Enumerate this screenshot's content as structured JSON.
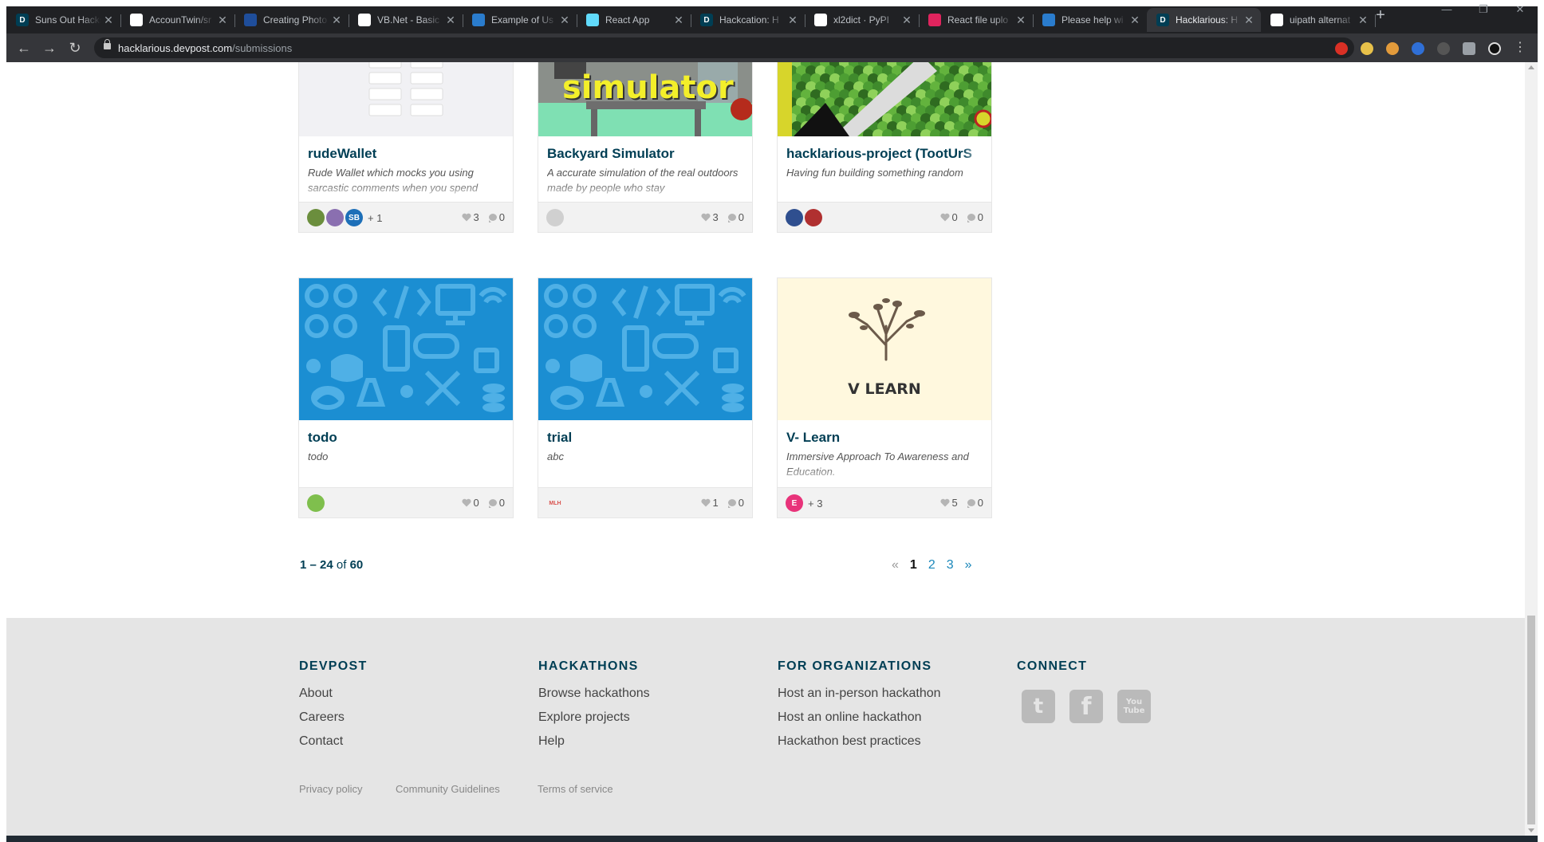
{
  "browser": {
    "tabs": [
      {
        "title": "Suns Out Hacks",
        "icon": "devpost-icon",
        "fav_color": "#003e54",
        "fav_glyph": "D"
      },
      {
        "title": "AccounTwin/sr",
        "icon": "github-icon",
        "fav_color": "#ffffff",
        "fav_glyph": ""
      },
      {
        "title": "Creating Photo",
        "icon": "site-icon",
        "fav_color": "#1f4e9b",
        "fav_glyph": ""
      },
      {
        "title": "VB.Net - Basic",
        "icon": "tutorialspoint-icon",
        "fav_color": "#ffffff",
        "fav_glyph": ""
      },
      {
        "title": "Example of Us",
        "icon": "uipath-icon",
        "fav_color": "#2a7ccd",
        "fav_glyph": ""
      },
      {
        "title": "React App",
        "icon": "react-icon",
        "fav_color": "#61dafb",
        "fav_glyph": ""
      },
      {
        "title": "Hackcation: H",
        "icon": "devpost-icon",
        "fav_color": "#003e54",
        "fav_glyph": "D"
      },
      {
        "title": "xl2dict · PyPI",
        "icon": "pypi-icon",
        "fav_color": "#ffffff",
        "fav_glyph": ""
      },
      {
        "title": "React file uplo",
        "icon": "heart-icon",
        "fav_color": "#e0245e",
        "fav_glyph": ""
      },
      {
        "title": "Please help wi",
        "icon": "uipath-icon",
        "fav_color": "#2a7ccd",
        "fav_glyph": ""
      },
      {
        "title": "Hacklarious: H",
        "icon": "devpost-icon",
        "fav_color": "#003e54",
        "fav_glyph": "D"
      },
      {
        "title": "uipath alternat",
        "icon": "google-icon",
        "fav_color": "#ffffff",
        "fav_glyph": ""
      }
    ],
    "active_tab": 10,
    "url_host": "hacklarious.devpost.com",
    "url_path": "/submissions"
  },
  "cards": [
    {
      "name": "rudeWallet",
      "tagline": "Rude Wallet which mocks you using sarcastic comments when you spend",
      "likes": "3",
      "comments": "0",
      "extra": "+ 1",
      "avatars": [
        "#6b8e3d",
        "#8a6fb0",
        "#1d6fb8"
      ],
      "av_text": [
        "",
        "",
        "SB"
      ],
      "thumb": "wallet"
    },
    {
      "name": "Backyard Simulator",
      "tagline": "A accurate simulation of the real outdoors made by people who stay",
      "likes": "3",
      "comments": "0",
      "extra": "",
      "avatars": [
        "#d0d0d0"
      ],
      "av_text": [
        ""
      ],
      "thumb": "simulator",
      "thumb_text": "simulator"
    },
    {
      "name": "hacklarious-project (TootUrS",
      "tagline": "Having fun building something random",
      "likes": "0",
      "comments": "0",
      "extra": "",
      "avatars": [
        "#2f4f8f",
        "#b03030"
      ],
      "av_text": [
        "",
        ""
      ],
      "thumb": "plant"
    },
    {
      "name": "todo",
      "tagline": "todo",
      "likes": "0",
      "comments": "0",
      "extra": "",
      "avatars": [
        "#7fbf4d"
      ],
      "av_text": [
        ""
      ],
      "thumb": "pattern"
    },
    {
      "name": "trial",
      "tagline": "abc",
      "likes": "1",
      "comments": "0",
      "extra": "",
      "avatars": [
        "#f2f2f2"
      ],
      "av_text": [
        "MLH"
      ],
      "thumb": "pattern"
    },
    {
      "name": "V- Learn",
      "tagline": "Immersive Approach To Awareness and Education.",
      "likes": "5",
      "comments": "0",
      "extra": "+ 3",
      "avatars": [
        "#e8337a"
      ],
      "av_text": [
        "E"
      ],
      "thumb": "vlearn",
      "thumb_text": "V LEARN"
    }
  ],
  "pagination": {
    "range": "1 – 24",
    "of": "of",
    "total": "60",
    "prev": "«",
    "pages": [
      "1",
      "2",
      "3"
    ],
    "current": "1",
    "next": "»"
  },
  "footer": {
    "columns": [
      {
        "heading": "DEVPOST",
        "links": [
          "About",
          "Careers",
          "Contact"
        ]
      },
      {
        "heading": "HACKATHONS",
        "links": [
          "Browse hackathons",
          "Explore projects",
          "Help"
        ]
      },
      {
        "heading": "FOR ORGANIZATIONS",
        "links": [
          "Host an in-person hackathon",
          "Host an online hackathon",
          "Hackathon best practices"
        ]
      },
      {
        "heading": "CONNECT",
        "links": []
      }
    ],
    "social": [
      {
        "name": "twitter-icon",
        "glyph": "t"
      },
      {
        "name": "facebook-icon",
        "glyph": "f"
      },
      {
        "name": "youtube-icon",
        "glyph": "You Tube"
      }
    ],
    "legal": [
      "Privacy policy",
      "Community Guidelines",
      "Terms of service"
    ]
  },
  "colors": {
    "brand_navy": "#003e54",
    "link_blue": "#1a87ba",
    "footer_bg": "#e5e5e5",
    "pattern_blue": "#1b8ed2"
  }
}
